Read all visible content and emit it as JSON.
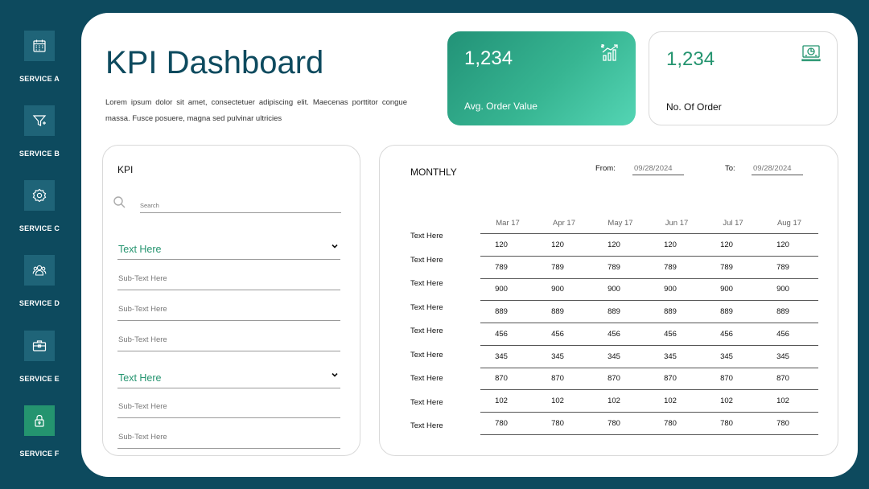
{
  "sidebar": {
    "items": [
      {
        "label": "SERVICE A",
        "icon": "calendar-icon"
      },
      {
        "label": "SERVICE B",
        "icon": "funnel-icon"
      },
      {
        "label": "SERVICE C",
        "icon": "settings-icon"
      },
      {
        "label": "SERVICE D",
        "icon": "team-icon"
      },
      {
        "label": "SERVICE E",
        "icon": "briefcase-icon"
      },
      {
        "label": "SERVICE F",
        "icon": "lock-icon",
        "active": true
      }
    ]
  },
  "header": {
    "title": "KPI Dashboard",
    "description": "Lorem ipsum dolor sit amet, consectetuer adipiscing elit. Maecenas porttitor congue massa. Fusce posuere, magna sed pulvinar ultricies"
  },
  "cards": [
    {
      "value": "1,234",
      "label": "Avg. Order Value",
      "icon": "growth-chart-icon"
    },
    {
      "value": "1,234",
      "label": "No. Of Order",
      "icon": "dashboard-monitor-icon"
    }
  ],
  "kpi_panel": {
    "title": "KPI",
    "search_placeholder": "Search",
    "groups": [
      {
        "heading": "Text Here",
        "items": [
          "Sub-Text Here",
          "Sub-Text Here",
          "Sub-Text Here"
        ]
      },
      {
        "heading": "Text Here",
        "items": [
          "Sub-Text Here",
          "Sub-Text Here"
        ]
      }
    ]
  },
  "monthly": {
    "title": "MONTHLY",
    "from_label": "From:",
    "from_value": "09/28/2024",
    "to_label": "To:",
    "to_value": "09/28/2024",
    "columns": [
      "Mar 17",
      "Apr 17",
      "May 17",
      "Jun 17",
      "Jul 17",
      "Aug 17"
    ],
    "rows": [
      {
        "label": "Text Here",
        "values": [
          "120",
          "120",
          "120",
          "120",
          "120",
          "120"
        ]
      },
      {
        "label": "Text Here",
        "values": [
          "789",
          "789",
          "789",
          "789",
          "789",
          "789"
        ]
      },
      {
        "label": "Text Here",
        "values": [
          "900",
          "900",
          "900",
          "900",
          "900",
          "900"
        ]
      },
      {
        "label": "Text Here",
        "values": [
          "889",
          "889",
          "889",
          "889",
          "889",
          "889"
        ]
      },
      {
        "label": "Text Here",
        "values": [
          "456",
          "456",
          "456",
          "456",
          "456",
          "456"
        ]
      },
      {
        "label": "Text Here",
        "values": [
          "345",
          "345",
          "345",
          "345",
          "345",
          "345"
        ]
      },
      {
        "label": "Text Here",
        "values": [
          "870",
          "870",
          "870",
          "870",
          "870",
          "870"
        ]
      },
      {
        "label": "Text Here",
        "values": [
          "102",
          "102",
          "102",
          "102",
          "102",
          "102"
        ]
      },
      {
        "label": "Text Here",
        "values": [
          "780",
          "780",
          "780",
          "780",
          "780",
          "780"
        ]
      }
    ]
  },
  "colors": {
    "sidebar_bg": "#0d4a5e",
    "accent_green": "#24946f",
    "title": "#0d4a5e"
  }
}
